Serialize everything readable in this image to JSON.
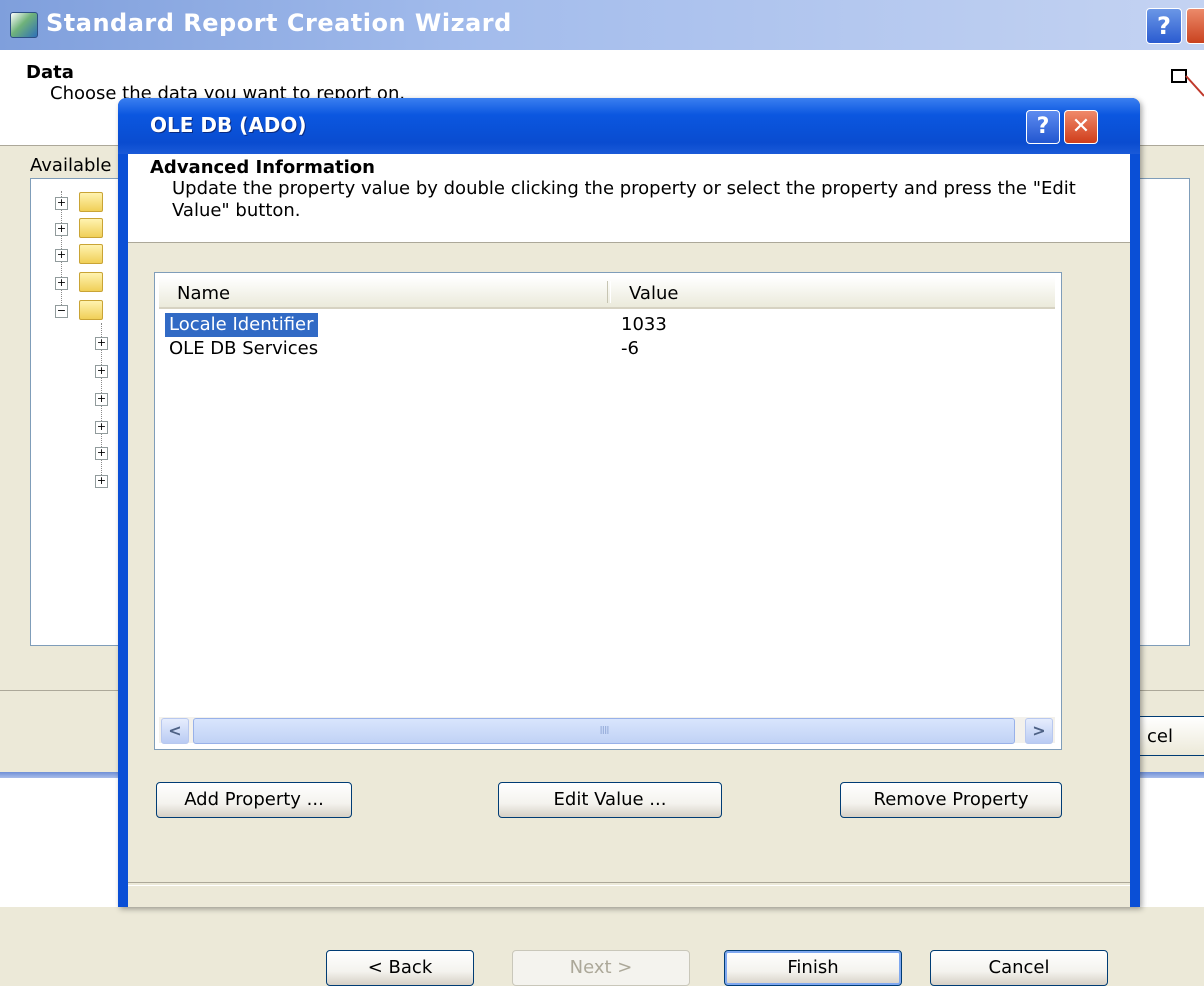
{
  "background_wizard": {
    "title": "Standard Report Creation Wizard",
    "help_glyph": "?",
    "section_title": "Data",
    "section_subtitle": "Choose the data you want to report on.",
    "available_label": "Available",
    "cancel_button_fragment": "cel",
    "tree_folders": 5,
    "tree_subitems": 6
  },
  "dialog": {
    "title": "OLE DB (ADO)",
    "help_glyph": "?",
    "close_glyph": "✕",
    "header": {
      "title": "Advanced Information",
      "description": "Update the property value by double clicking the property or select the property and press the \"Edit Value\" button."
    },
    "properties": {
      "columns": {
        "name": "Name",
        "value": "Value"
      },
      "rows": [
        {
          "name": "Locale Identifier",
          "value": "1033",
          "selected": true
        },
        {
          "name": "OLE DB Services",
          "value": "-6",
          "selected": false
        }
      ],
      "scroll_left": "<",
      "scroll_right": ">",
      "scroll_grip": "IIII"
    },
    "buttons": {
      "add_property": "Add Property ...",
      "edit_value": "Edit Value ...",
      "remove_property": "Remove Property"
    },
    "nav": {
      "back": "< Back",
      "next": "Next >",
      "finish": "Finish",
      "cancel": "Cancel"
    }
  },
  "colors": {
    "title_blue": "#0a4fd6",
    "selection": "#316ac5",
    "window_face": "#ece9d8"
  }
}
